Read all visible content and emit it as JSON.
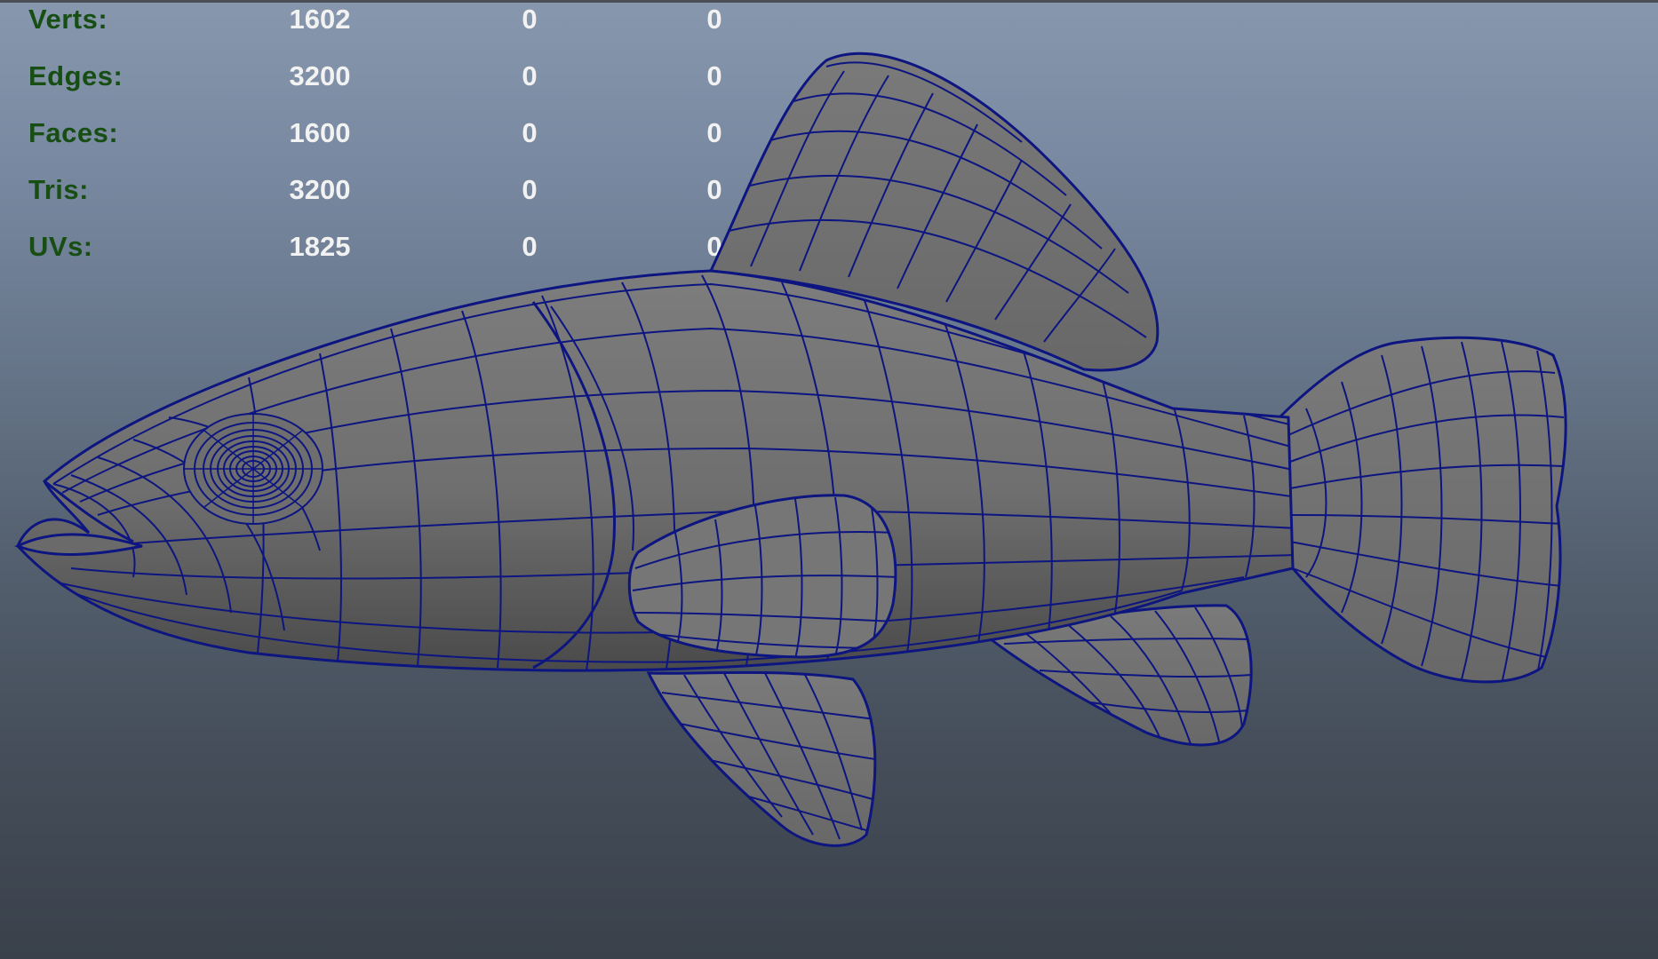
{
  "hud": {
    "rows": [
      {
        "label": "Verts:",
        "values": [
          "1602",
          "0",
          "0"
        ]
      },
      {
        "label": "Edges:",
        "values": [
          "3200",
          "0",
          "0"
        ]
      },
      {
        "label": "Faces:",
        "values": [
          "1600",
          "0",
          "0"
        ]
      },
      {
        "label": "Tris:",
        "values": [
          "3200",
          "0",
          "0"
        ]
      },
      {
        "label": "UVs:",
        "values": [
          "1825",
          "0",
          "0"
        ]
      }
    ]
  },
  "model": {
    "icon": "fish-wireframe-mesh",
    "wire_color": "#0d1580",
    "shade_color": "#727272"
  }
}
